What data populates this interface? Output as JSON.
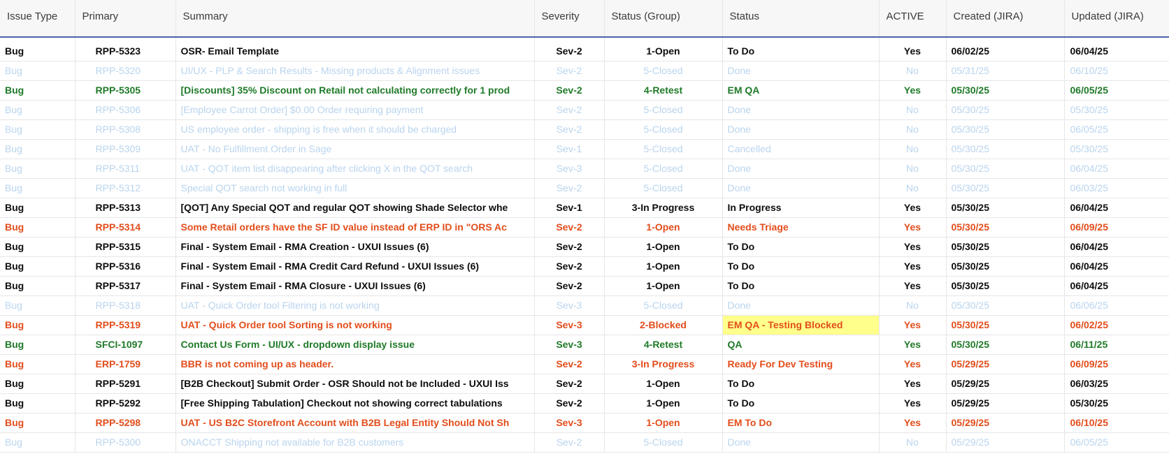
{
  "columns": [
    "Issue Type",
    "Primary",
    "Summary",
    "Severity",
    "Status (Group)",
    "Status",
    "ACTIVE",
    "Created (JIRA)",
    "Updated (JIRA)"
  ],
  "colors": {
    "black": "#0d0d0d",
    "muted": "#b9d4ee",
    "green": "#1f7a28",
    "orange": "#e24d1b",
    "highlight": "#ffff8c",
    "header_rule": "#4a63a8"
  },
  "rows": [
    {
      "style": "black",
      "type": "Bug",
      "primary": "RPP-5323",
      "summary": "OSR- Email Template",
      "severity": "Sev-2",
      "group": "1-Open",
      "status": "To Do",
      "active": "Yes",
      "created": "06/02/25",
      "updated": "06/04/25"
    },
    {
      "style": "muted",
      "type": "Bug",
      "primary": "RPP-5320",
      "summary": "UI/UX - PLP & Search Results - Missing products & Alignment issues",
      "severity": "Sev-2",
      "group": "5-Closed",
      "status": "Done",
      "active": "No",
      "created": "05/31/25",
      "updated": "06/10/25"
    },
    {
      "style": "green",
      "type": "Bug",
      "primary": "RPP-5305",
      "summary": "[Discounts] 35% Discount on Retail not calculating correctly for 1 prod",
      "severity": "Sev-2",
      "group": "4-Retest",
      "status": "EM QA",
      "active": "Yes",
      "created": "05/30/25",
      "updated": "06/05/25"
    },
    {
      "style": "muted",
      "type": "Bug",
      "primary": "RPP-5306",
      "summary": "[Employee Carrot Order] $0.00 Order requiring payment",
      "severity": "Sev-2",
      "group": "5-Closed",
      "status": "Done",
      "active": "No",
      "created": "05/30/25",
      "updated": "05/30/25"
    },
    {
      "style": "muted",
      "type": "Bug",
      "primary": "RPP-5308",
      "summary": "US employee order - shipping is free when it should be charged",
      "severity": "Sev-2",
      "group": "5-Closed",
      "status": "Done",
      "active": "No",
      "created": "05/30/25",
      "updated": "06/05/25"
    },
    {
      "style": "muted",
      "type": "Bug",
      "primary": "RPP-5309",
      "summary": "UAT - No Fulfillment Order in Sage",
      "severity": "Sev-1",
      "group": "5-Closed",
      "status": "Cancelled",
      "active": "No",
      "created": "05/30/25",
      "updated": "05/30/25"
    },
    {
      "style": "muted",
      "type": "Bug",
      "primary": "RPP-5311",
      "summary": "UAT - QOT item list disappearing after clicking X in the QOT search",
      "severity": "Sev-3",
      "group": "5-Closed",
      "status": "Done",
      "active": "No",
      "created": "05/30/25",
      "updated": "06/04/25"
    },
    {
      "style": "muted",
      "type": "Bug",
      "primary": "RPP-5312",
      "summary": "Special QOT search not working in full",
      "severity": "Sev-2",
      "group": "5-Closed",
      "status": "Done",
      "active": "No",
      "created": "05/30/25",
      "updated": "06/03/25"
    },
    {
      "style": "black",
      "type": "Bug",
      "primary": "RPP-5313",
      "summary": "[QOT] Any Special QOT and regular QOT showing Shade Selector whe",
      "severity": "Sev-1",
      "group": "3-In Progress",
      "status": "In Progress",
      "active": "Yes",
      "created": "05/30/25",
      "updated": "06/04/25"
    },
    {
      "style": "orange",
      "type": "Bug",
      "primary": "RPP-5314",
      "summary": "Some Retail orders have the SF ID value instead of ERP ID in \"ORS Ac",
      "severity": "Sev-2",
      "group": "1-Open",
      "status": "Needs Triage",
      "active": "Yes",
      "created": "05/30/25",
      "updated": "06/09/25"
    },
    {
      "style": "black",
      "type": "Bug",
      "primary": "RPP-5315",
      "summary": "Final - System Email - RMA Creation - UXUI Issues (6)",
      "severity": "Sev-2",
      "group": "1-Open",
      "status": "To Do",
      "active": "Yes",
      "created": "05/30/25",
      "updated": "06/04/25"
    },
    {
      "style": "black",
      "type": "Bug",
      "primary": "RPP-5316",
      "summary": "Final - System Email - RMA Credit Card Refund - UXUI Issues (6)",
      "severity": "Sev-2",
      "group": "1-Open",
      "status": "To Do",
      "active": "Yes",
      "created": "05/30/25",
      "updated": "06/04/25"
    },
    {
      "style": "black",
      "type": "Bug",
      "primary": "RPP-5317",
      "summary": "Final - System Email - RMA Closure - UXUI Issues (6)",
      "severity": "Sev-2",
      "group": "1-Open",
      "status": "To Do",
      "active": "Yes",
      "created": "05/30/25",
      "updated": "06/04/25"
    },
    {
      "style": "muted",
      "type": "Bug",
      "primary": "RPP-5318",
      "summary": "UAT - Quick Order tool Filtering is not working",
      "severity": "Sev-3",
      "group": "5-Closed",
      "status": "Done",
      "active": "No",
      "created": "05/30/25",
      "updated": "06/06/25"
    },
    {
      "style": "orange",
      "type": "Bug",
      "primary": "RPP-5319",
      "summary": "UAT - Quick Order tool Sorting is not working",
      "severity": "Sev-3",
      "group": "2-Blocked",
      "status": "EM QA - Testing Blocked",
      "active": "Yes",
      "created": "05/30/25",
      "updated": "06/02/25",
      "highlight": true
    },
    {
      "style": "green",
      "type": "Bug",
      "primary": "SFCI-1097",
      "summary": "Contact Us Form - UI/UX - dropdown display issue",
      "severity": "Sev-3",
      "group": "4-Retest",
      "status": "QA",
      "active": "Yes",
      "created": "05/30/25",
      "updated": "06/11/25"
    },
    {
      "style": "orange",
      "type": "Bug",
      "primary": "ERP-1759",
      "summary": "BBR is not coming up as header.",
      "severity": "Sev-2",
      "group": "3-In Progress",
      "status": "Ready For Dev Testing",
      "active": "Yes",
      "created": "05/29/25",
      "updated": "06/09/25"
    },
    {
      "style": "black",
      "type": "Bug",
      "primary": "RPP-5291",
      "summary": "[B2B Checkout] Submit Order - OSR Should not be Included - UXUI Iss",
      "severity": "Sev-2",
      "group": "1-Open",
      "status": "To Do",
      "active": "Yes",
      "created": "05/29/25",
      "updated": "06/03/25"
    },
    {
      "style": "black",
      "type": "Bug",
      "primary": "RPP-5292",
      "summary": "[Free Shipping Tabulation] Checkout not showing correct tabulations",
      "severity": "Sev-2",
      "group": "1-Open",
      "status": "To Do",
      "active": "Yes",
      "created": "05/29/25",
      "updated": "05/30/25"
    },
    {
      "style": "orange",
      "type": "Bug",
      "primary": "RPP-5298",
      "summary": "UAT - US B2C Storefront Account with B2B Legal Entity Should Not Sh",
      "severity": "Sev-3",
      "group": "1-Open",
      "status": "EM To Do",
      "active": "Yes",
      "created": "05/29/25",
      "updated": "06/10/25"
    },
    {
      "style": "muted",
      "type": "Bug",
      "primary": "RPP-5300",
      "summary": "ONACCT Shipping not available for B2B customers",
      "severity": "Sev-2",
      "group": "5-Closed",
      "status": "Done",
      "active": "No",
      "created": "05/29/25",
      "updated": "06/05/25"
    }
  ]
}
